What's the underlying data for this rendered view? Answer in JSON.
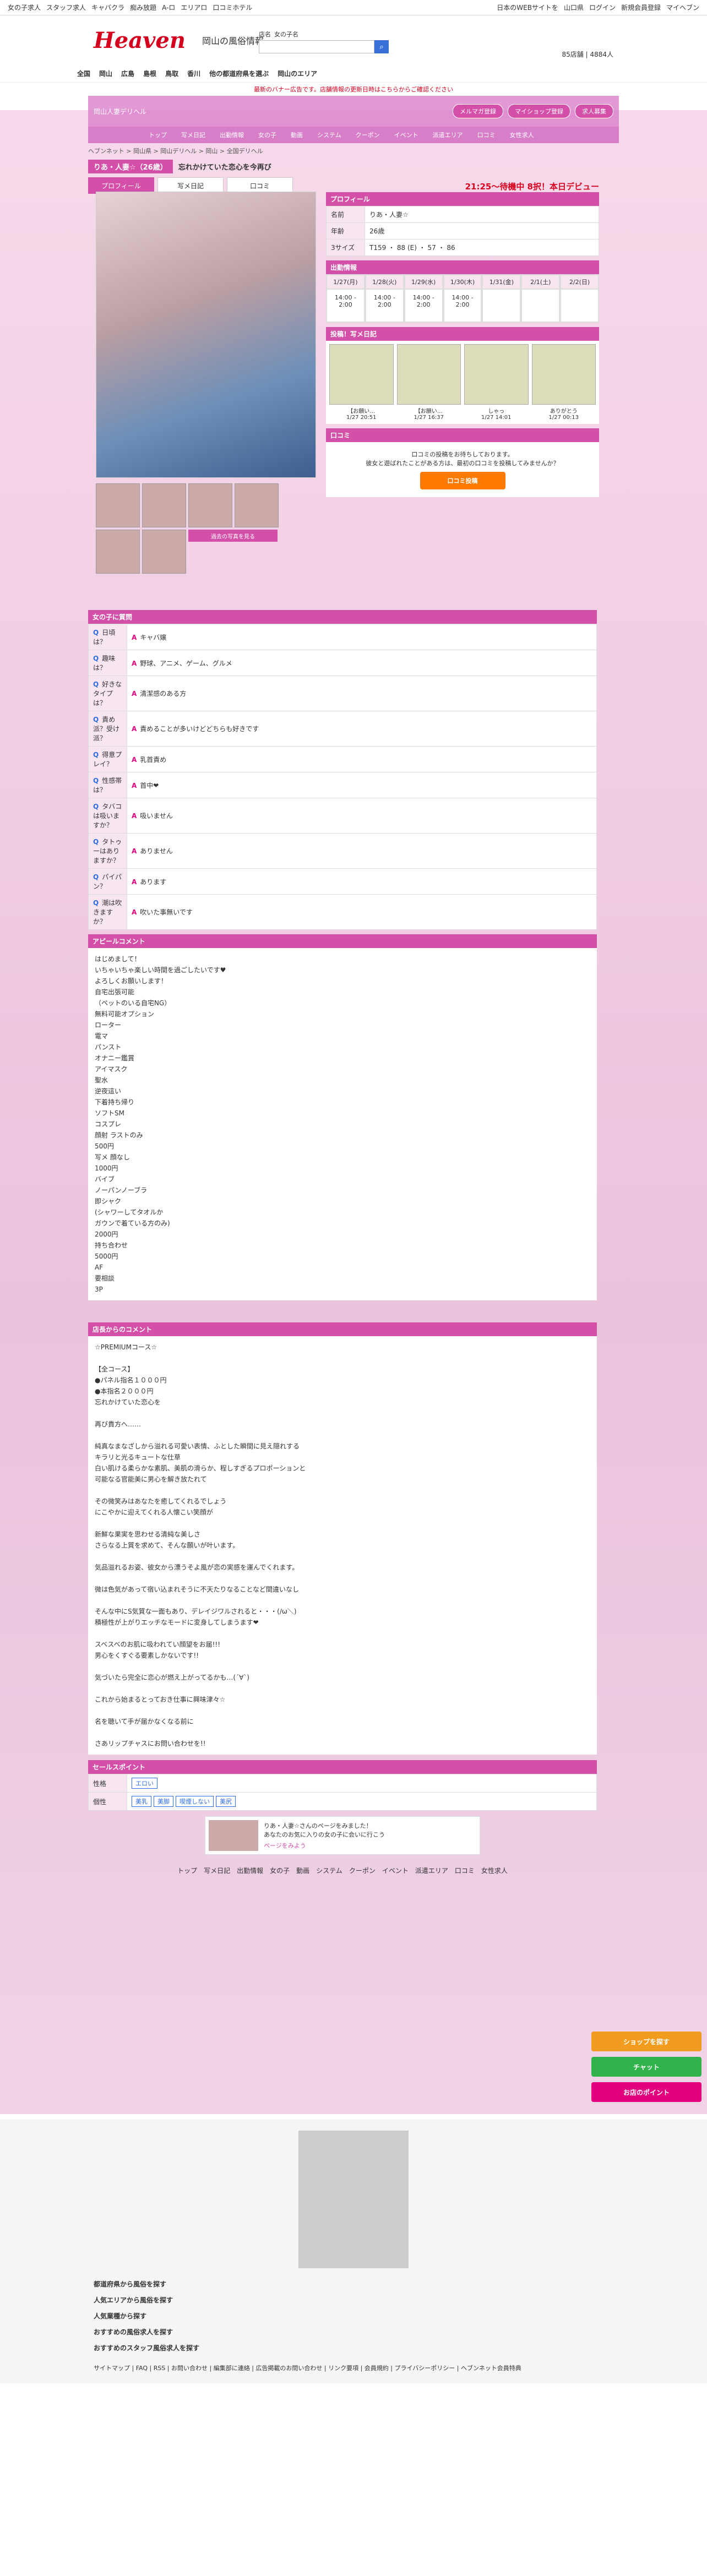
{
  "top": {
    "links": [
      "女の子求人",
      "スタッフ求人",
      "キャバクラ",
      "痴み放題",
      "A-ロ",
      "エリアロ",
      "口コミホテル"
    ],
    "right": [
      "日本のWEBサイトを",
      "山口県",
      "ログイン",
      "新規会員登録",
      "マイヘブン"
    ]
  },
  "header": {
    "logo": "Heaven",
    "region": "岡山の風俗情報",
    "search_tabs": [
      "店名",
      "女の子名"
    ],
    "search_placeholder": "",
    "stats_a": "85店舗",
    "stats_b": "4884人"
  },
  "nav": [
    "全国",
    "岡山",
    "広島",
    "島根",
    "鳥取",
    "香川",
    "他の都道府県を選ぶ",
    "岡山のエリア"
  ],
  "notice": "最新のバナー広告です。店舗情報の更新日時はこちらからご確認ください",
  "shop": {
    "name": "岡山人妻デリヘル",
    "btn1": "メルマガ登録",
    "btn2": "マイショップ登録",
    "btn3": "求人募集",
    "nav": [
      "トップ",
      "写メ日記",
      "出勤情報",
      "女の子",
      "動画",
      "システム",
      "クーポン",
      "イベント",
      "派遣エリア",
      "口コミ",
      "女性求人"
    ]
  },
  "crumb": "ヘブンネット > 岡山県 > 岡山デリヘル > 岡山 > 全国デリヘル",
  "girl": {
    "name": "りあ・人妻☆（26歳）",
    "tagline": "忘れかけていた恋心を今再び",
    "tabs": [
      "プロフィール",
      "写メ日記",
      "口コミ"
    ],
    "debut": "21:25〜待機中 8択！本日デビュー"
  },
  "profile": {
    "title": "プロフィール",
    "rows": [
      [
        "名前",
        "りあ・人妻☆"
      ],
      [
        "年齢",
        "26歳"
      ],
      [
        "3サイズ",
        "T159 ・ 88 (E) ・ 57 ・ 86"
      ]
    ]
  },
  "schedule": {
    "title": "出勤情報",
    "days": [
      "1/27(月)",
      "1/28(火)",
      "1/29(水)",
      "1/30(木)",
      "1/31(金)",
      "2/1(土)",
      "2/2(日)"
    ],
    "times": [
      "14:00 - 2:00",
      "14:00 - 2:00",
      "14:00 - 2:00",
      "14:00 - 2:00",
      "",
      "",
      ""
    ]
  },
  "diary": {
    "title": "投稿！写メ日記",
    "items": [
      [
        "【お願い…",
        "1/27 20:51"
      ],
      [
        "【お願い…",
        "1/27 16:37"
      ],
      [
        "しゃっ",
        "1/27 14:01"
      ],
      [
        "ありがとう",
        "1/27 00:13"
      ]
    ]
  },
  "kuchi": {
    "title": "口コミ",
    "text1": "口コミの投稿をお待ちしております。",
    "text2": "彼女と遊ばれたことがある方は、最初の口コミを投稿してみませんか？",
    "btn": "口コミ投稿"
  },
  "thumbs_btn": "過去の写真を見る",
  "qa": {
    "title": "女の子に質問",
    "rows": [
      [
        "日頃は？",
        "キャバ嬢"
      ],
      [
        "趣味は？",
        "野球、アニメ、ゲーム、グルメ"
      ],
      [
        "好きなタイプは？",
        "清潔感のある方"
      ],
      [
        "責め派？受け派？",
        "責めることが多いけどどちらも好きです"
      ],
      [
        "得意プレイ？",
        "乳首責め"
      ],
      [
        "性感帯は？",
        "首中❤"
      ],
      [
        "タバコは吸いますか？",
        "吸いません"
      ],
      [
        "タトゥーはありますか？",
        "ありません"
      ],
      [
        "パイパン？",
        "あります"
      ],
      [
        "潮は吹きますか？",
        "吹いた事無いです"
      ]
    ]
  },
  "appeal": {
    "title": "アピールコメント",
    "text": "はじめまして！\nいちゃいちゃ楽しい時間を過ごしたいです♥\nよろしくお願いします！\n自宅出張可能\n（ペットのいる自宅NG）\n無料可能オプション\nローター\n電マ\nパンスト\nオナニー鑑賞\nアイマスク\n聖水\n逆夜這い\n下着持ち帰り\nソフトSM\nコスプレ\n顔射 ラストのみ\n500円\n写メ 顔なし\n1000円\nバイブ\nノーパンノーブラ\n即シャク\n(シャワーしてタオルか\nガウンで着ている方のみ)\n2000円\n持ち合わせ\n5000円\nAF\n要相談\n3P"
  },
  "shopcomment": {
    "title": "店長からのコメント",
    "text": "☆PREMIUMコース☆\n\n【全コース】\n●パネル指名１０００円\n●本指名２０００円\n忘れかけていた恋心を\n\n再び貴方へ……\n\n純真なまなざしから溢れる可愛い表情、ふとした瞬間に見え隠れする\nキラリと光るキュートな仕草\n白い肌ける柔らかな素肌、美肌の滑らか、程しすぎるプロポーションと\n可能なる官能美に男心を解き放たれて\n\nその微笑みはあなたを癒してくれるでしょう\nにこやかに迎えてくれる人懐こい笑顔が\n\n新鮮な果実を思わせる清純な美しさ\nさらなる上質を求めて、そんな願いが叶います。\n\n気品溢れるお姿、彼女から漂うそよ風が恋の実感を運んでくれます。\n\n微は色気があって宿い込まれそうに不天たりなることなど間違いなし\n\nそんな中にS気質な一面もあり、デレイジワルされると・・・(/ω＼)\n積極性が上がりエッチなモードに変身してしまうます❤\n\nスベスベのお肌に吸われてい顔望をお届!!!\n男心をくすぐる要素しかないです!!\n\n気づいたら完全に恋心が燃え上がってるかも…(´∀`)\n\nこれから始まるとっておき仕事に興味津々☆\n\n名を聴いて手が届かなくなる前に\n\nさあリップチャスにお問い合わせを!!"
  },
  "sales": {
    "title": "セールスポイント",
    "r1": "性格",
    "r1v": [
      "エロい"
    ],
    "r2": "個性",
    "r2v": [
      "美乳",
      "美脚",
      "喫煙しない",
      "美尻"
    ]
  },
  "banner": {
    "text1": "りあ・人妻☆さんのページをみました！",
    "text2": "あなたのお気に入りの女の子に会いに行こう",
    "btn": "ページをみよう"
  },
  "footnav": [
    "トップ",
    "写メ日記",
    "出勤情報",
    "女の子",
    "動画",
    "システム",
    "クーポン",
    "イベント",
    "派遣エリア",
    "口コミ",
    "女性求人"
  ],
  "footer": {
    "h1": "都道府県から風俗を探す",
    "h2": "人気エリアから風俗を探す",
    "h3": "人気業種から探す",
    "h4": "おすすめの風俗求人を探す",
    "h5": "おすすめのスタッフ風俗求人を探す",
    "links": "サイトマップ | FAQ | RSS | お問い合わせ | 編集部に連絡 | 広告掲載のお問い合わせ | リンク要項 | 会員規約 | プライバシーポリシー | ヘブンネット会員特典"
  },
  "side": [
    "ショップを探す",
    "チャット",
    "お店のポイント"
  ]
}
